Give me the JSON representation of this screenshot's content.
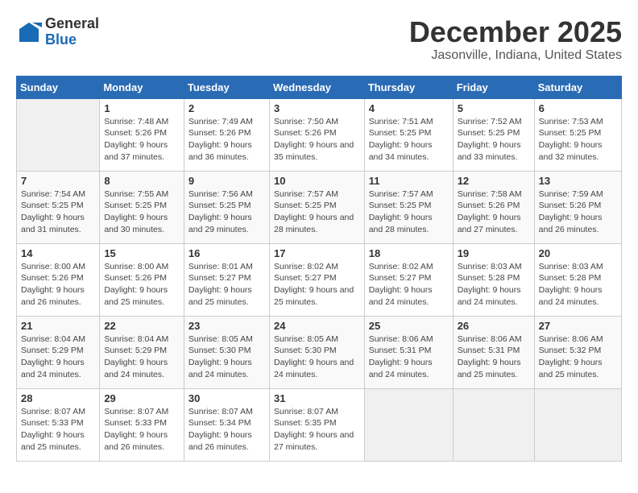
{
  "header": {
    "logo_general": "General",
    "logo_blue": "Blue",
    "month_title": "December 2025",
    "location": "Jasonville, Indiana, United States"
  },
  "days_of_week": [
    "Sunday",
    "Monday",
    "Tuesday",
    "Wednesday",
    "Thursday",
    "Friday",
    "Saturday"
  ],
  "weeks": [
    [
      {
        "day": "",
        "sunrise": "",
        "sunset": "",
        "daylight": ""
      },
      {
        "day": "1",
        "sunrise": "Sunrise: 7:48 AM",
        "sunset": "Sunset: 5:26 PM",
        "daylight": "Daylight: 9 hours and 37 minutes."
      },
      {
        "day": "2",
        "sunrise": "Sunrise: 7:49 AM",
        "sunset": "Sunset: 5:26 PM",
        "daylight": "Daylight: 9 hours and 36 minutes."
      },
      {
        "day": "3",
        "sunrise": "Sunrise: 7:50 AM",
        "sunset": "Sunset: 5:26 PM",
        "daylight": "Daylight: 9 hours and 35 minutes."
      },
      {
        "day": "4",
        "sunrise": "Sunrise: 7:51 AM",
        "sunset": "Sunset: 5:25 PM",
        "daylight": "Daylight: 9 hours and 34 minutes."
      },
      {
        "day": "5",
        "sunrise": "Sunrise: 7:52 AM",
        "sunset": "Sunset: 5:25 PM",
        "daylight": "Daylight: 9 hours and 33 minutes."
      },
      {
        "day": "6",
        "sunrise": "Sunrise: 7:53 AM",
        "sunset": "Sunset: 5:25 PM",
        "daylight": "Daylight: 9 hours and 32 minutes."
      }
    ],
    [
      {
        "day": "7",
        "sunrise": "Sunrise: 7:54 AM",
        "sunset": "Sunset: 5:25 PM",
        "daylight": "Daylight: 9 hours and 31 minutes."
      },
      {
        "day": "8",
        "sunrise": "Sunrise: 7:55 AM",
        "sunset": "Sunset: 5:25 PM",
        "daylight": "Daylight: 9 hours and 30 minutes."
      },
      {
        "day": "9",
        "sunrise": "Sunrise: 7:56 AM",
        "sunset": "Sunset: 5:25 PM",
        "daylight": "Daylight: 9 hours and 29 minutes."
      },
      {
        "day": "10",
        "sunrise": "Sunrise: 7:57 AM",
        "sunset": "Sunset: 5:25 PM",
        "daylight": "Daylight: 9 hours and 28 minutes."
      },
      {
        "day": "11",
        "sunrise": "Sunrise: 7:57 AM",
        "sunset": "Sunset: 5:25 PM",
        "daylight": "Daylight: 9 hours and 28 minutes."
      },
      {
        "day": "12",
        "sunrise": "Sunrise: 7:58 AM",
        "sunset": "Sunset: 5:26 PM",
        "daylight": "Daylight: 9 hours and 27 minutes."
      },
      {
        "day": "13",
        "sunrise": "Sunrise: 7:59 AM",
        "sunset": "Sunset: 5:26 PM",
        "daylight": "Daylight: 9 hours and 26 minutes."
      }
    ],
    [
      {
        "day": "14",
        "sunrise": "Sunrise: 8:00 AM",
        "sunset": "Sunset: 5:26 PM",
        "daylight": "Daylight: 9 hours and 26 minutes."
      },
      {
        "day": "15",
        "sunrise": "Sunrise: 8:00 AM",
        "sunset": "Sunset: 5:26 PM",
        "daylight": "Daylight: 9 hours and 25 minutes."
      },
      {
        "day": "16",
        "sunrise": "Sunrise: 8:01 AM",
        "sunset": "Sunset: 5:27 PM",
        "daylight": "Daylight: 9 hours and 25 minutes."
      },
      {
        "day": "17",
        "sunrise": "Sunrise: 8:02 AM",
        "sunset": "Sunset: 5:27 PM",
        "daylight": "Daylight: 9 hours and 25 minutes."
      },
      {
        "day": "18",
        "sunrise": "Sunrise: 8:02 AM",
        "sunset": "Sunset: 5:27 PM",
        "daylight": "Daylight: 9 hours and 24 minutes."
      },
      {
        "day": "19",
        "sunrise": "Sunrise: 8:03 AM",
        "sunset": "Sunset: 5:28 PM",
        "daylight": "Daylight: 9 hours and 24 minutes."
      },
      {
        "day": "20",
        "sunrise": "Sunrise: 8:03 AM",
        "sunset": "Sunset: 5:28 PM",
        "daylight": "Daylight: 9 hours and 24 minutes."
      }
    ],
    [
      {
        "day": "21",
        "sunrise": "Sunrise: 8:04 AM",
        "sunset": "Sunset: 5:29 PM",
        "daylight": "Daylight: 9 hours and 24 minutes."
      },
      {
        "day": "22",
        "sunrise": "Sunrise: 8:04 AM",
        "sunset": "Sunset: 5:29 PM",
        "daylight": "Daylight: 9 hours and 24 minutes."
      },
      {
        "day": "23",
        "sunrise": "Sunrise: 8:05 AM",
        "sunset": "Sunset: 5:30 PM",
        "daylight": "Daylight: 9 hours and 24 minutes."
      },
      {
        "day": "24",
        "sunrise": "Sunrise: 8:05 AM",
        "sunset": "Sunset: 5:30 PM",
        "daylight": "Daylight: 9 hours and 24 minutes."
      },
      {
        "day": "25",
        "sunrise": "Sunrise: 8:06 AM",
        "sunset": "Sunset: 5:31 PM",
        "daylight": "Daylight: 9 hours and 24 minutes."
      },
      {
        "day": "26",
        "sunrise": "Sunrise: 8:06 AM",
        "sunset": "Sunset: 5:31 PM",
        "daylight": "Daylight: 9 hours and 25 minutes."
      },
      {
        "day": "27",
        "sunrise": "Sunrise: 8:06 AM",
        "sunset": "Sunset: 5:32 PM",
        "daylight": "Daylight: 9 hours and 25 minutes."
      }
    ],
    [
      {
        "day": "28",
        "sunrise": "Sunrise: 8:07 AM",
        "sunset": "Sunset: 5:33 PM",
        "daylight": "Daylight: 9 hours and 25 minutes."
      },
      {
        "day": "29",
        "sunrise": "Sunrise: 8:07 AM",
        "sunset": "Sunset: 5:33 PM",
        "daylight": "Daylight: 9 hours and 26 minutes."
      },
      {
        "day": "30",
        "sunrise": "Sunrise: 8:07 AM",
        "sunset": "Sunset: 5:34 PM",
        "daylight": "Daylight: 9 hours and 26 minutes."
      },
      {
        "day": "31",
        "sunrise": "Sunrise: 8:07 AM",
        "sunset": "Sunset: 5:35 PM",
        "daylight": "Daylight: 9 hours and 27 minutes."
      },
      {
        "day": "",
        "sunrise": "",
        "sunset": "",
        "daylight": ""
      },
      {
        "day": "",
        "sunrise": "",
        "sunset": "",
        "daylight": ""
      },
      {
        "day": "",
        "sunrise": "",
        "sunset": "",
        "daylight": ""
      }
    ]
  ]
}
